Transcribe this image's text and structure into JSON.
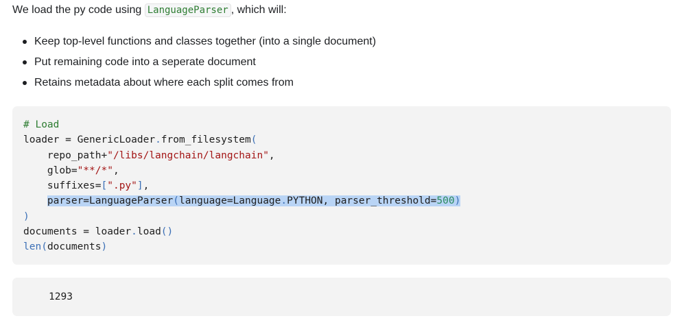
{
  "intro": {
    "before": "We load the py code using ",
    "code": "LanguageParser",
    "after": ", which will:"
  },
  "bullets": [
    "Keep top-level functions and classes together (into a single document)",
    "Put remaining code into a seperate document",
    "Retains metadata about where each split comes from"
  ],
  "code": {
    "comment": "# Load",
    "l2_a": "loader = GenericLoader",
    "l2_dot": ".",
    "l2_b": "from_filesystem",
    "l2_paren": "(",
    "l3_a": "    repo_path+",
    "l3_str": "\"/libs/langchain/langchain\"",
    "l3_end": ",",
    "l4_a": "    glob=",
    "l4_str": "\"**/*\"",
    "l4_end": ",",
    "l5_a": "    suffixes=",
    "l5_br": "[",
    "l5_str": "\".py\"",
    "l5_br2": "]",
    "l5_end": ",",
    "l6_indent": "    ",
    "l6_a": "parser=LanguageParser",
    "l6_p1": "(",
    "l6_b": "language=Language",
    "l6_dot": ".",
    "l6_c": "PYTHON, parser_threshold=",
    "l6_num": "500",
    "l6_p2": ")",
    "l7": ")",
    "l8_a": "documents = loader",
    "l8_dot": ".",
    "l8_b": "load",
    "l8_p": "()",
    "l9_fn": "len",
    "l9_p1": "(",
    "l9_a": "documents",
    "l9_p2": ")"
  },
  "output": {
    "value": "1293"
  }
}
